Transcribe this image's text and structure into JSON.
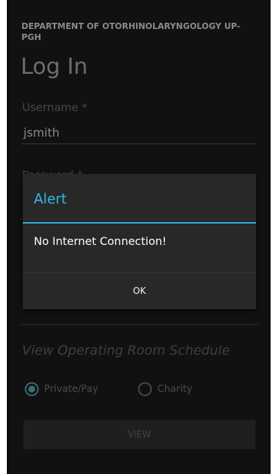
{
  "header": {
    "department": "DEPARTMENT OF OTORHINOLARYNGOLOGY UP-PGH",
    "title": "Log In"
  },
  "form": {
    "username_label": "Username *",
    "username_value": "jsmith",
    "password_label_partial": "Password *"
  },
  "schedule": {
    "section_title": "View Operating Room Schedule",
    "options": [
      {
        "label": "Private/Pay",
        "checked": true
      },
      {
        "label": "Charity",
        "checked": false
      }
    ],
    "view_button": "VIEW"
  },
  "dialog": {
    "title": "Alert",
    "message": "No Internet Connection!",
    "ok_button": "OK"
  },
  "colors": {
    "accent": "#33b5e5",
    "background": "#111111",
    "dialog_background": "#282828"
  }
}
